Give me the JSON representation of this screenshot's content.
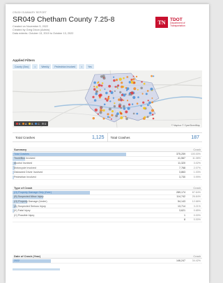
{
  "report": {
    "kicker": "CRASH SUMMARY REPORT",
    "title": "SR049 Chetham County 7.25-8",
    "created_on": "Created on November 5, 2022",
    "created_by": "Created by Greg Dixon (Admin)",
    "date_extents": "Data extents: October 13, 2019 to October 13, 2022"
  },
  "logo": {
    "mark": "TN",
    "name": "TDOT",
    "sub1": "Department of",
    "sub2": "Transportation",
    "color": "#c8102e"
  },
  "filters": {
    "title": "Applied Filters",
    "chips": [
      "County (Geo)",
      "=",
      "Weekly",
      "Pedestrian Involved",
      "=",
      "Yes"
    ]
  },
  "map": {
    "attribution": "© Mapbox © OpenStreetMap",
    "legend": [
      {
        "label": "K",
        "color": "#e23b3b"
      },
      {
        "label": "A",
        "color": "#f08a24"
      },
      {
        "label": "B",
        "color": "#f5c518"
      },
      {
        "label": "C",
        "color": "#4a90d9"
      },
      {
        "label": "O",
        "color": "#8c8c8c"
      }
    ]
  },
  "totals": {
    "left_label": "Total Crashes",
    "left_value": "1,125",
    "right_label": "Total Crashes",
    "right_value": "187"
  },
  "summary": {
    "title": "Summary",
    "col": "Crash",
    "rows": [
      {
        "label": "Total Crashes",
        "count": "375,259",
        "pct": "100.00%",
        "frac": 1.0
      },
      {
        "label": "Truck/Bus Involved",
        "count": "41,567",
        "pct": "11.08%",
        "frac": 0.11
      },
      {
        "label": "Alcohol Involved",
        "count": "11,320",
        "pct": "3.02%",
        "frac": 0.03
      },
      {
        "label": "Motorcycle Involved",
        "count": "7,768",
        "pct": "2.07%",
        "frac": 0.02
      },
      {
        "label": "Distracted Driver Involved",
        "count": "3,863",
        "pct": "1.03%",
        "frac": 0.01
      },
      {
        "label": "Pedestrian Involved",
        "count": "3,730",
        "pct": "0.99%",
        "frac": 0.01
      }
    ]
  },
  "type_of_crash": {
    "title": "Type of Crash",
    "col": "Crash",
    "rows": [
      {
        "label": "(O) Property Damage Only (Over)",
        "count": "289,174",
        "pct": "67.64%",
        "frac": 0.68
      },
      {
        "label": "(B) Suspected Minor Injury",
        "count": "114,742",
        "pct": "26.84%",
        "frac": 0.27
      },
      {
        "label": "(O) Property Damage (Under)",
        "count": "54,143",
        "pct": "12.66%",
        "frac": 0.13
      },
      {
        "label": "(A) Suspected Serious Injury",
        "count": "13,714",
        "pct": "3.21%",
        "frac": 0.03
      },
      {
        "label": "(K) Fatal Injury",
        "count": "3,621",
        "pct": "0.85%",
        "frac": 0.01
      },
      {
        "label": "(C) Possible Injury",
        "count": "1",
        "pct": "0.00%",
        "frac": 0.0
      },
      {
        "label": "",
        "count": "8",
        "pct": "0.00%",
        "frac": 0.0
      }
    ]
  },
  "date_of_crash": {
    "title": "Date of Crash (Year)",
    "col": "Crash",
    "rows": [
      {
        "label": "2022",
        "count": "146,247",
        "pct": "34.42%",
        "frac": 0.34
      }
    ]
  }
}
